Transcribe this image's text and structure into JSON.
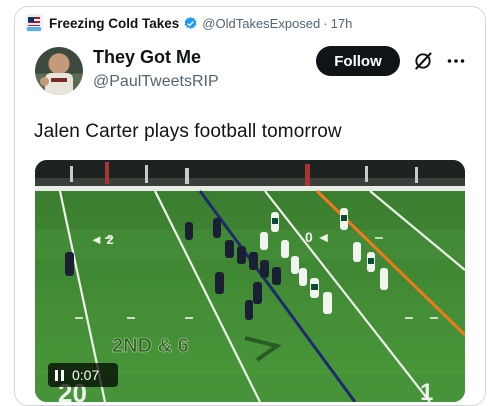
{
  "quote": {
    "name": "Freezing Cold Takes",
    "handle": "@OldTakesExposed",
    "separator": "·",
    "time": "17h"
  },
  "tweet": {
    "name": "They Got Me",
    "handle": "@PaulTweetsRIP",
    "follow_label": "Follow",
    "text": "Jalen Carter plays football tomorrow"
  },
  "video": {
    "timestamp": "0:07",
    "field_text_down": "2ND & 6",
    "yard_left": "20",
    "yard_right": "1"
  },
  "colors": {
    "follow_bg": "#0f1419",
    "verified": "#1d9bf0",
    "field": "#3f8a34",
    "first_down_line": "#f07a1a",
    "scrimmage_line": "#1e2a6e"
  },
  "icons": [
    "verified-icon",
    "grok-icon",
    "more-icon",
    "pause-icon"
  ]
}
